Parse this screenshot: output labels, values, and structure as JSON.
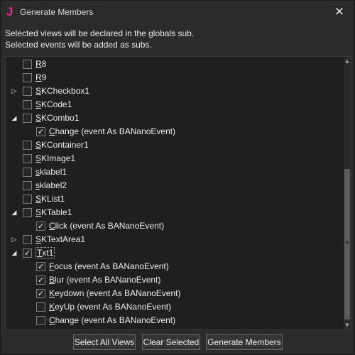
{
  "window": {
    "title": "Generate Members",
    "app_icon_glyph": "J",
    "close_glyph": "✕"
  },
  "info": {
    "line1": "Selected views will be declared in the globals sub.",
    "line2": "Selected events will be added as subs."
  },
  "tree": {
    "rows": [
      {
        "label": "R8",
        "checked": false,
        "expander": ""
      },
      {
        "label": "R9",
        "checked": false,
        "expander": ""
      },
      {
        "label": "SKCheckbox1",
        "checked": false,
        "expander": "▷"
      },
      {
        "label": "SKCode1",
        "checked": false,
        "expander": ""
      },
      {
        "label": "SKCombo1",
        "checked": false,
        "expander": "◢"
      },
      {
        "label": "Change (event As BANanoEvent)",
        "checked": true,
        "expander": ""
      },
      {
        "label": "SKContainer1",
        "checked": false,
        "expander": ""
      },
      {
        "label": "SKImage1",
        "checked": false,
        "expander": ""
      },
      {
        "label": "sklabel1",
        "checked": false,
        "expander": ""
      },
      {
        "label": "sklabel2",
        "checked": false,
        "expander": ""
      },
      {
        "label": "SKList1",
        "checked": false,
        "expander": ""
      },
      {
        "label": "SKTable1",
        "checked": false,
        "expander": "◢"
      },
      {
        "label": "Click (event As BANanoEvent)",
        "checked": true,
        "expander": ""
      },
      {
        "label": "SKTextArea1",
        "checked": false,
        "expander": "▷"
      },
      {
        "label": "Txt1",
        "checked": true,
        "expander": "◢"
      },
      {
        "label": "Focus (event As BANanoEvent)",
        "checked": true,
        "expander": ""
      },
      {
        "label": "Blur (event As BANanoEvent)",
        "checked": true,
        "expander": ""
      },
      {
        "label": "Keydown (event As BANanoEvent)",
        "checked": true,
        "expander": ""
      },
      {
        "label": "KeyUp (event As BANanoEvent)",
        "checked": false,
        "expander": ""
      },
      {
        "label": "Change (event As BANanoEvent)",
        "checked": false,
        "expander": ""
      }
    ]
  },
  "buttons": {
    "select_all": "Select All Views",
    "clear": "Clear Selected",
    "generate": "Generate Members"
  },
  "icons": {
    "check": "✓",
    "scroll_up": "▲",
    "scroll_down": "▼",
    "grip": "≡",
    "resize": "⋰"
  },
  "colors": {
    "background": "#2b2b2b",
    "tree_background": "#1f1f1f",
    "accent_icon": "#e0358a",
    "text": "#ececec"
  }
}
